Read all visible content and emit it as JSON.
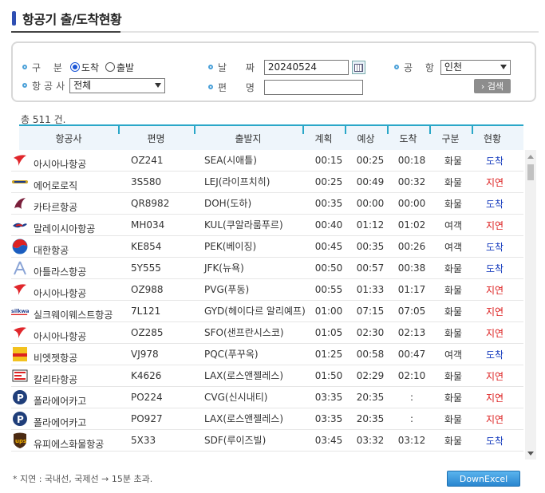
{
  "page": {
    "title": "항공기 출/도착현황"
  },
  "search": {
    "type_label": "구 분",
    "type_options": [
      {
        "label": "도착",
        "selected": true
      },
      {
        "label": "출발",
        "selected": false
      }
    ],
    "airline_label": "항공사",
    "airline_value": "전체",
    "date_label": "날 짜",
    "date_value": "20240524",
    "flight_label": "편 명",
    "flight_value": "",
    "airport_label": "공 항",
    "airport_value": "인천",
    "search_button": "› 검색"
  },
  "total_text": "총 511 건.",
  "table": {
    "headers": [
      "항공사",
      "편명",
      "출발지",
      "계획",
      "예상",
      "도착",
      "구분",
      "현황"
    ],
    "rows": [
      {
        "logo": "asiana-icon",
        "airline": "아시아나항공",
        "flight": "OZ241",
        "origin": "SEA(시애틀)",
        "plan": "00:15",
        "expected": "00:25",
        "arrival": "00:18",
        "type": "화물",
        "status": "도착"
      },
      {
        "logo": "aerologic-icon",
        "airline": "에어로로직",
        "flight": "3S580",
        "origin": "LEJ(라이프치히)",
        "plan": "00:25",
        "expected": "00:49",
        "arrival": "00:32",
        "type": "화물",
        "status": "지연"
      },
      {
        "logo": "qatar-icon",
        "airline": "카타르항공",
        "flight": "QR8982",
        "origin": "DOH(도하)",
        "plan": "00:35",
        "expected": "00:00",
        "arrival": "00:00",
        "type": "화물",
        "status": "도착"
      },
      {
        "logo": "malaysia-icon",
        "airline": "말레이시아항공",
        "flight": "MH034",
        "origin": "KUL(쿠알라룸푸르)",
        "plan": "00:40",
        "expected": "01:12",
        "arrival": "01:02",
        "type": "여객",
        "status": "지연"
      },
      {
        "logo": "koreanair-icon",
        "airline": "대한항공",
        "flight": "KE854",
        "origin": "PEK(베이징)",
        "plan": "00:45",
        "expected": "00:35",
        "arrival": "00:26",
        "type": "여객",
        "status": "도착"
      },
      {
        "logo": "atlas-icon",
        "airline": "아틀라스항공",
        "flight": "5Y555",
        "origin": "JFK(뉴욕)",
        "plan": "00:50",
        "expected": "00:57",
        "arrival": "00:38",
        "type": "화물",
        "status": "도착"
      },
      {
        "logo": "asiana-icon",
        "airline": "아시아나항공",
        "flight": "OZ988",
        "origin": "PVG(푸동)",
        "plan": "00:55",
        "expected": "01:33",
        "arrival": "01:17",
        "type": "화물",
        "status": "지연"
      },
      {
        "logo": "silkway-icon",
        "airline": "실크웨이웨스트항공",
        "flight": "7L121",
        "origin": "GYD(헤이다르 알리예프)",
        "plan": "01:00",
        "expected": "07:15",
        "arrival": "07:05",
        "type": "화물",
        "status": "지연"
      },
      {
        "logo": "asiana-icon",
        "airline": "아시아나항공",
        "flight": "OZ285",
        "origin": "SFO(샌프란시스코)",
        "plan": "01:05",
        "expected": "02:30",
        "arrival": "02:13",
        "type": "화물",
        "status": "지연"
      },
      {
        "logo": "vietjet-icon",
        "airline": "비엣젯항공",
        "flight": "VJ978",
        "origin": "PQC(푸꾸옥)",
        "plan": "01:25",
        "expected": "00:58",
        "arrival": "00:47",
        "type": "여객",
        "status": "도착"
      },
      {
        "logo": "kalitta-icon",
        "airline": "칼리타항공",
        "flight": "K4626",
        "origin": "LAX(로스앤젤레스)",
        "plan": "01:50",
        "expected": "02:29",
        "arrival": "02:10",
        "type": "화물",
        "status": "지연"
      },
      {
        "logo": "polar-icon",
        "airline": "폴라에어카고",
        "flight": "PO224",
        "origin": "CVG(신시내티)",
        "plan": "03:35",
        "expected": "20:35",
        "arrival": ":",
        "type": "화물",
        "status": "지연"
      },
      {
        "logo": "polar-icon",
        "airline": "폴라에어카고",
        "flight": "PO927",
        "origin": "LAX(로스앤젤레스)",
        "plan": "03:35",
        "expected": "20:35",
        "arrival": ":",
        "type": "화물",
        "status": "지연"
      },
      {
        "logo": "ups-icon",
        "airline": "유피에스화물항공",
        "flight": "5X33",
        "origin": "SDF(루이즈빌)",
        "plan": "03:45",
        "expected": "03:32",
        "arrival": "03:12",
        "type": "화물",
        "status": "도착"
      }
    ]
  },
  "footer": {
    "note": "* 지연 : 국내선, 국제선 → 15분 초과.",
    "excel_button": "DownExcel"
  },
  "colors": {
    "arrived": "#1a3fbf",
    "delayed": "#dd2222",
    "accent": "#2aa7c8"
  }
}
